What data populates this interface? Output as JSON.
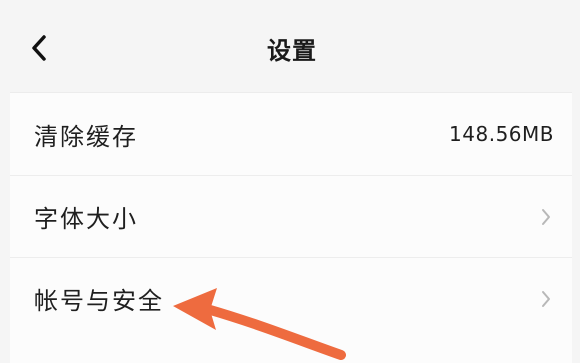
{
  "header": {
    "title": "设置",
    "back_icon": "chevron-left-icon"
  },
  "settings": {
    "items": [
      {
        "label": "清除缓存",
        "value": "148.56MB",
        "trailing_icon": ""
      },
      {
        "label": "字体大小",
        "value": "",
        "trailing_icon": "chevron-right-icon"
      },
      {
        "label": "帐号与安全",
        "value": "",
        "trailing_icon": "chevron-right-icon"
      }
    ]
  },
  "annotation": {
    "arrow_color": "#ee6b3f"
  },
  "colors": {
    "page_background": "#f5f5f5",
    "panel_background": "#fcfcfc",
    "text": "#1f1f1f",
    "muted": "#b8b8b8"
  }
}
